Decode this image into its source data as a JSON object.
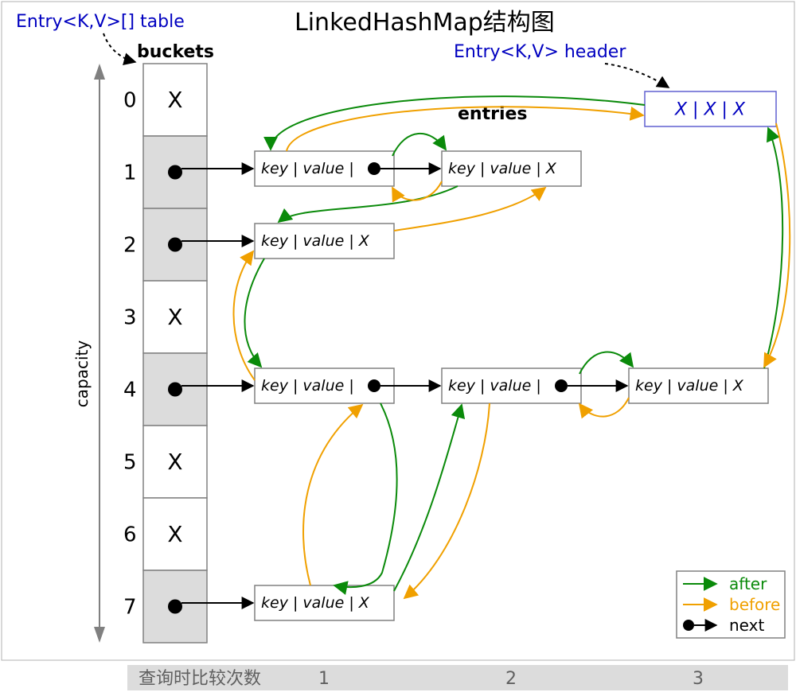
{
  "title": "LinkedHashMap结构图",
  "labels": {
    "tableType": "Entry<K,V>[] table",
    "buckets": "buckets",
    "entries": "entries",
    "headerType": "Entry<K,V> header",
    "capacity": "capacity",
    "footerText": "查询时比较次数",
    "footer1": "1",
    "footer2": "2",
    "footer3": "3"
  },
  "buckets": [
    {
      "index": "0",
      "filled": false,
      "symbol": "X"
    },
    {
      "index": "1",
      "filled": true,
      "symbol": "●"
    },
    {
      "index": "2",
      "filled": true,
      "symbol": "●"
    },
    {
      "index": "3",
      "filled": false,
      "symbol": "X"
    },
    {
      "index": "4",
      "filled": true,
      "symbol": "●"
    },
    {
      "index": "5",
      "filled": false,
      "symbol": "X"
    },
    {
      "index": "6",
      "filled": false,
      "symbol": "X"
    },
    {
      "index": "7",
      "filled": true,
      "symbol": "●"
    }
  ],
  "entryText": {
    "keyvalueDot": "key | value |",
    "keyvalueX": "key | value |  X",
    "header": "X  |  X  |  X"
  },
  "legend": {
    "after": "after",
    "before": "before",
    "next": "next"
  },
  "colors": {
    "after": "#0a8a0a",
    "before": "#f0a000",
    "next": "#000000",
    "bucketFill": "#dcdcdc",
    "bucketEmpty": "#ffffff"
  }
}
